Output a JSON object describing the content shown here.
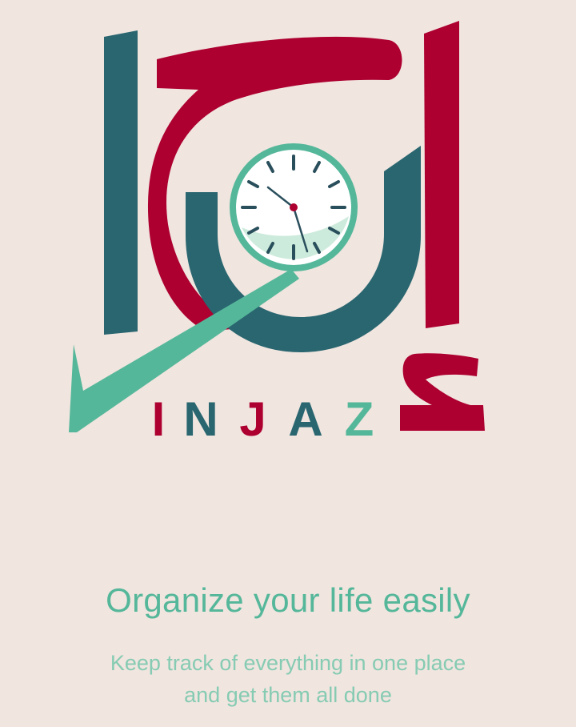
{
  "onboarding": {
    "logo": {
      "wordmark_letters": [
        "I",
        "N",
        "J",
        "A",
        "Z"
      ],
      "icon": "clock-checkmark-logo-icon",
      "arabic_mark": "إنجاز"
    },
    "headline": "Organize your life easily",
    "subtitle_line1": "Keep track of everything in one place",
    "subtitle_line2": "and get them all done"
  },
  "colors": {
    "background": "#f0e5df",
    "crimson": "#ad0030",
    "teal_dark": "#2a6670",
    "mint": "#55b79a",
    "mint_light": "#86cbb3"
  }
}
